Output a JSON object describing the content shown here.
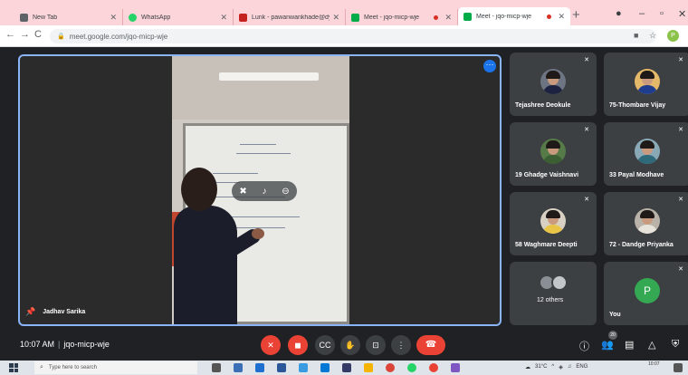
{
  "browser": {
    "tabs": [
      {
        "title": "New Tab",
        "favicon_color": "#5f6368",
        "active": false
      },
      {
        "title": "WhatsApp",
        "favicon_color": "#25d366",
        "active": false
      },
      {
        "title": "Lunk - pawanwankhade@dyp",
        "favicon_color": "#c5221f",
        "active": false
      },
      {
        "title": "Meet - jqo-micp-wje",
        "favicon_color": "#00ac47",
        "active": false
      },
      {
        "title": "Meet - jqo-micp-wje",
        "favicon_color": "#00ac47",
        "active": true
      }
    ],
    "new_tab_glyph": "+",
    "url": "meet.google.com/jqo-micp-wje",
    "profile_initial": "P"
  },
  "meeting": {
    "main_tile": {
      "name": "Jadhav Sarika",
      "more_icon": "more-horizontal-icon"
    },
    "participants": [
      {
        "name": "Tejashree Deokule",
        "shirt_color": "#1d2240"
      },
      {
        "name": "75-Thombare Vijay",
        "shirt_color": "#1e3d8f"
      },
      {
        "name": "19 Ghadge Vaishnavi",
        "shirt_color": "#3b5f32"
      },
      {
        "name": "33 Payal Modhave",
        "shirt_color": "#2f6a7b"
      },
      {
        "name": "58 Waghmare Deepti",
        "shirt_color": "#e8c547"
      },
      {
        "name": "72 - Dandge Priyanka",
        "shirt_color": "#e7e2da"
      },
      {
        "name": "12 others",
        "shirt_color": "#8a8f96"
      },
      {
        "name": "You",
        "initial": "P",
        "initial_color": "#34a853"
      }
    ],
    "time": "10:07 AM",
    "code": "jqo-micp-wje",
    "accent_color": "#8ab4f8",
    "danger_color": "#ea4335",
    "people_count": "20"
  },
  "taskbar": {
    "search_placeholder": "Type here to search",
    "weather": "31°C",
    "language": "ENG",
    "clock_time": "10:07"
  }
}
